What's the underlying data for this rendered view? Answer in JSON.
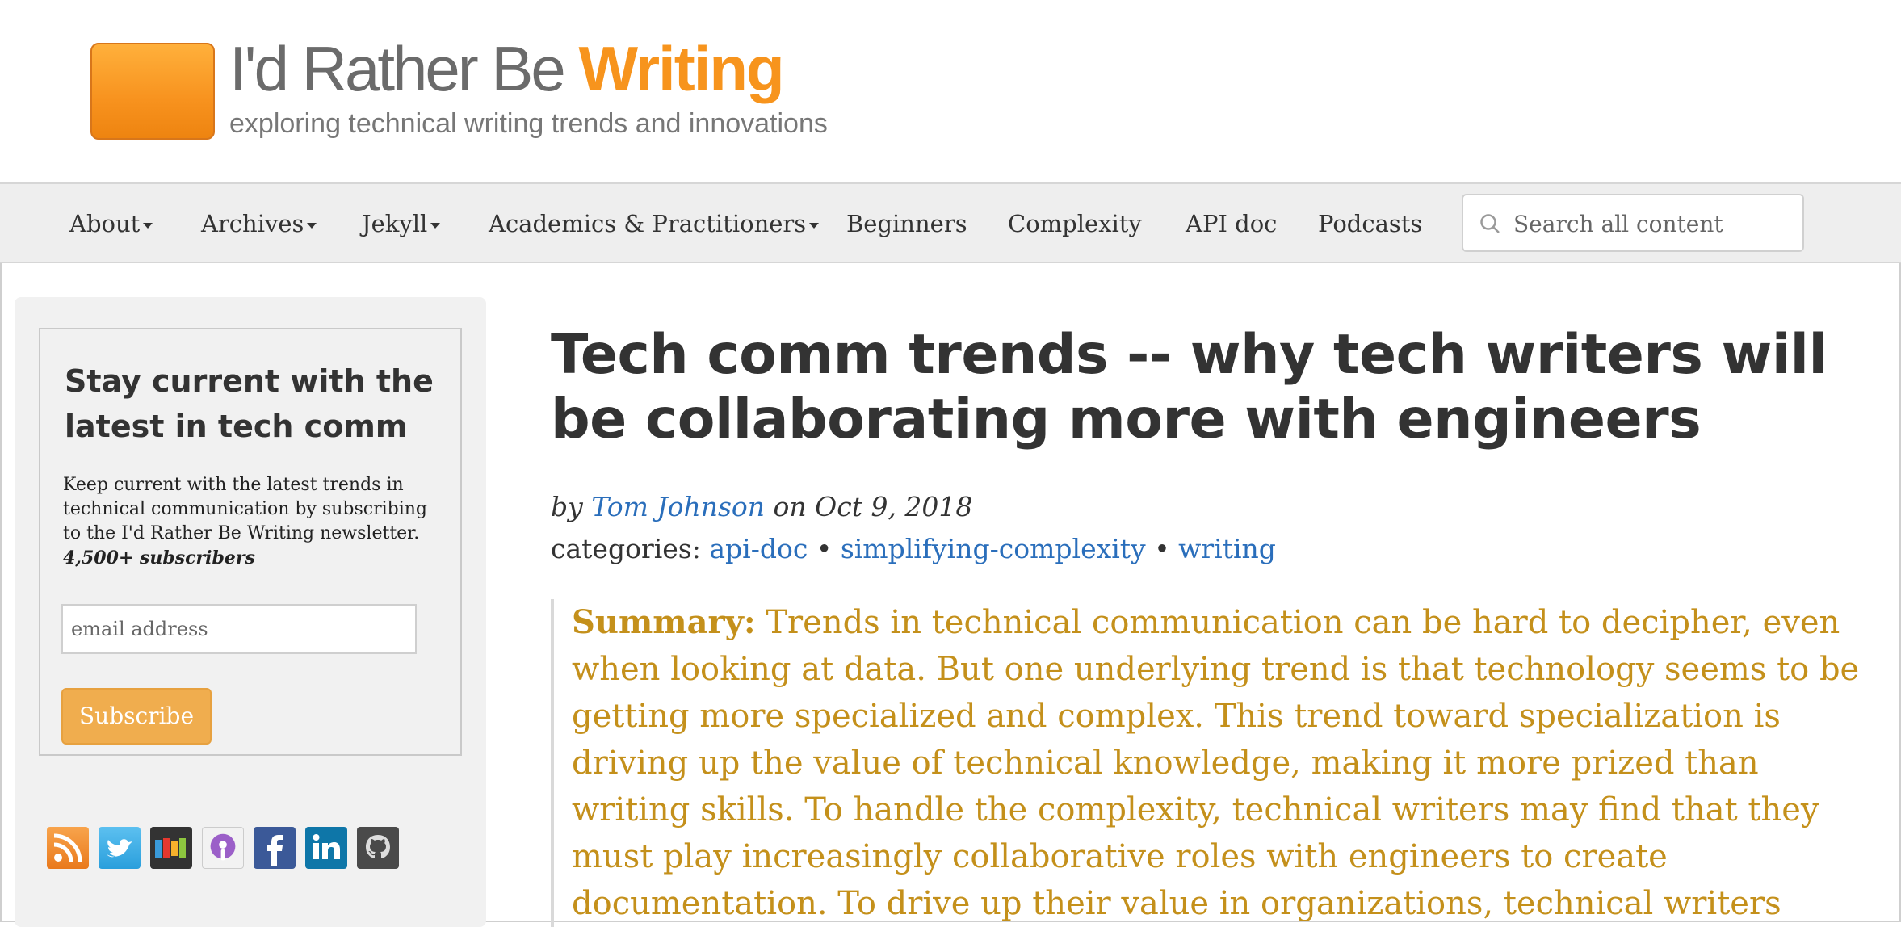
{
  "site": {
    "title_main": "I'd Rather Be ",
    "title_accent": "Writing",
    "tagline": "exploring technical writing trends and innovations"
  },
  "nav": {
    "items": [
      {
        "label": "About",
        "dropdown": true
      },
      {
        "label": "Archives",
        "dropdown": true
      },
      {
        "label": "Jekyll",
        "dropdown": true
      },
      {
        "label": "Academics & Practitioners",
        "dropdown": true
      },
      {
        "label": "Beginners",
        "dropdown": false
      },
      {
        "label": "Complexity",
        "dropdown": false
      },
      {
        "label": "API doc",
        "dropdown": false
      },
      {
        "label": "Podcasts",
        "dropdown": false
      }
    ],
    "search_placeholder": "Search all content"
  },
  "sidebar": {
    "heading": "Stay current with the latest in tech comm",
    "text": "Keep current with the latest trends in technical communication by subscribing to the I'd Rather Be Writing newsletter.",
    "subscribers": "4,500+ subscribers",
    "email_placeholder": "email address",
    "subscribe_label": "Subscribe",
    "social_icons": [
      "rss-icon",
      "twitter-icon",
      "stitcher-icon",
      "podcast-icon",
      "facebook-icon",
      "linkedin-icon",
      "github-icon"
    ]
  },
  "post": {
    "title": "Tech comm trends -- why tech writers will be collaborating more with engineers",
    "by": "by",
    "author": "Tom Johnson",
    "on": "on",
    "date": "Oct 9, 2018",
    "categories_label": "categories:",
    "categories": [
      "api-doc",
      "simplifying-complexity",
      "writing"
    ],
    "category_separator": "•",
    "summary_label": "Summary:",
    "summary_text": "Trends in technical communication can be hard to decipher, even when looking at data. But one underlying trend is that technology seems to be getting more specialized and complex. This trend toward specialization is driving up the value of technical knowledge, making it more prized than writing skills. To handle the complexity, technical writers may find that they must play increasingly collaborative roles with engineers to create documentation. To drive up their value in organizations, technical writers"
  },
  "colors": {
    "accent_orange": "#f7941d",
    "link_blue": "#2a6ebb",
    "summary_gold": "#c4901b",
    "subscribe_button": "#f0ad4e"
  }
}
